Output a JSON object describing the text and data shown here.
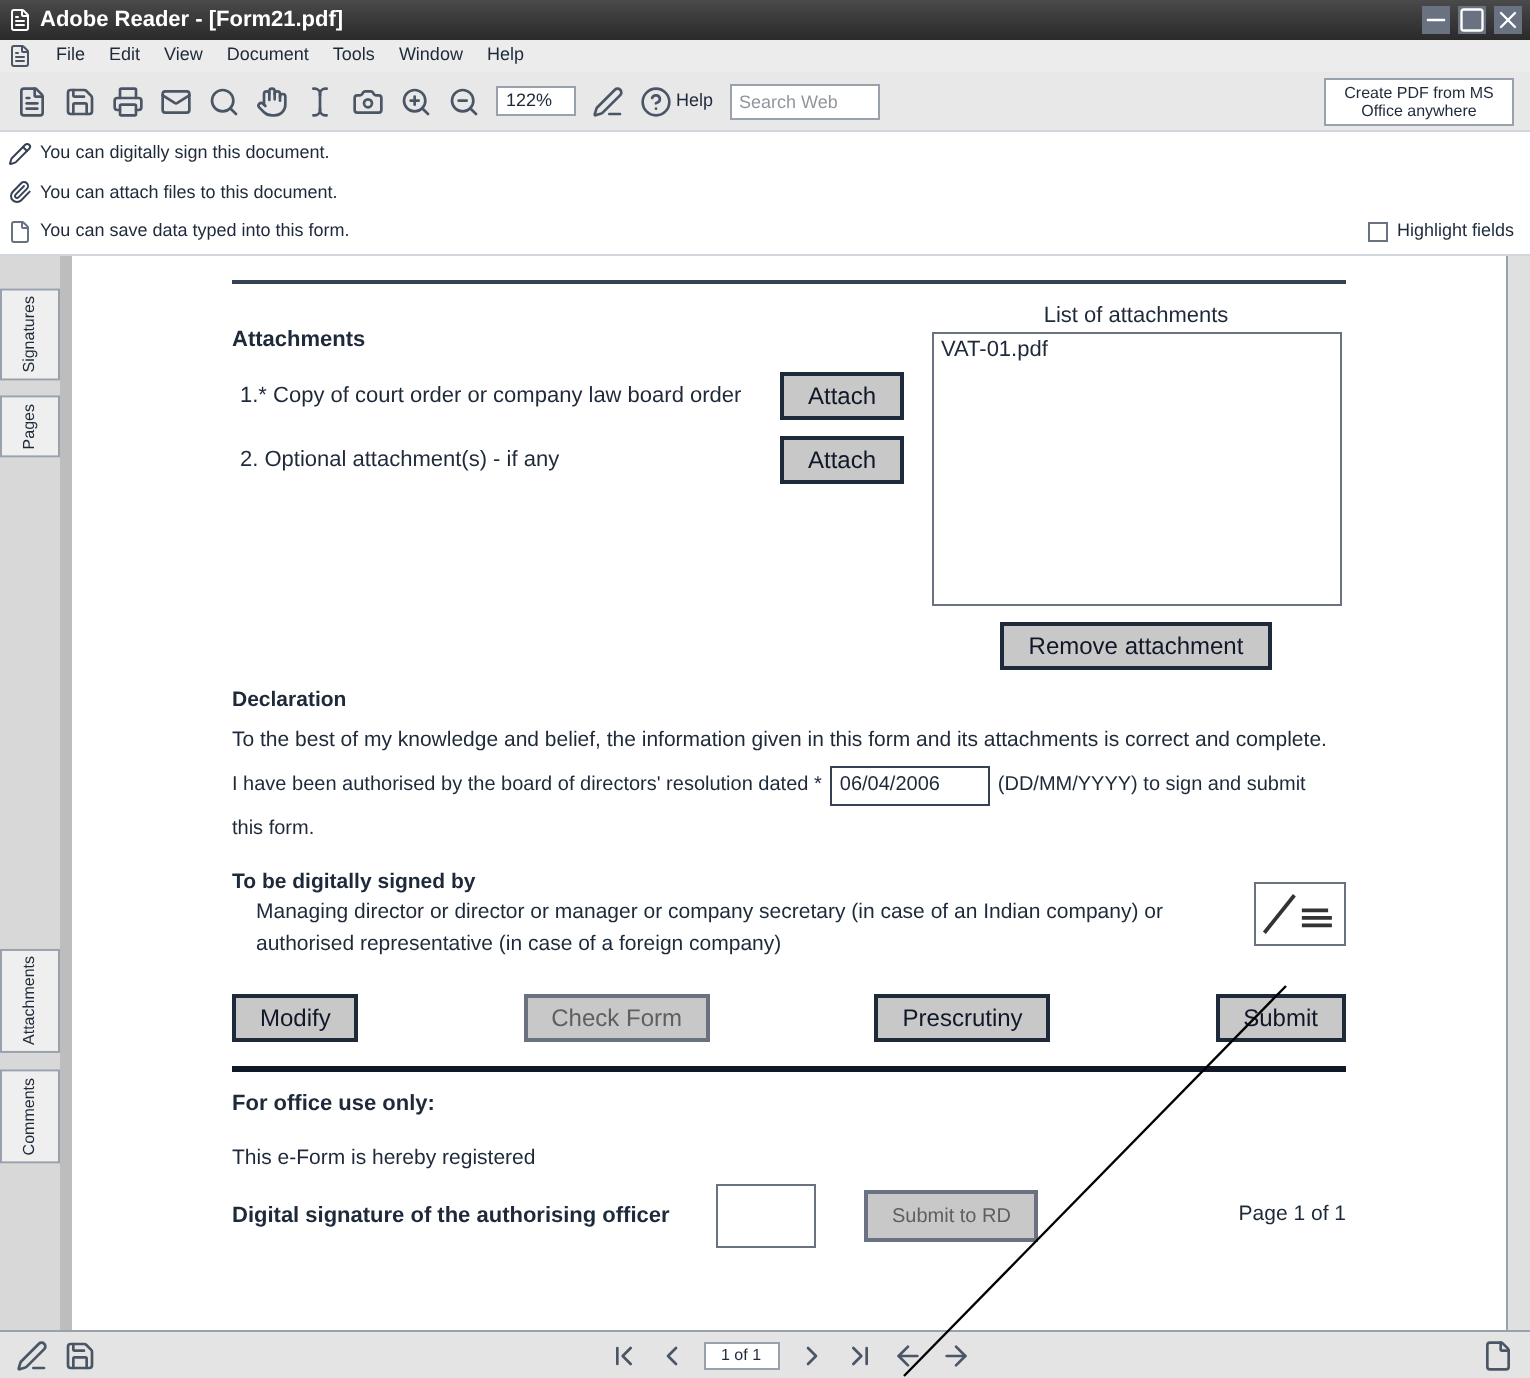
{
  "window": {
    "title": "Adobe Reader - [Form21.pdf]"
  },
  "menu": [
    "File",
    "Edit",
    "View",
    "Document",
    "Tools",
    "Window",
    "Help"
  ],
  "toolbar": {
    "zoom": "122%",
    "help": "Help",
    "search_placeholder": "Search Web",
    "create_pdf": "Create PDF from MS Office anywhere"
  },
  "messages": [
    {
      "kind": "sign",
      "text": "You can digitally sign this document."
    },
    {
      "kind": "attach",
      "text": "You can attach files to this document."
    },
    {
      "kind": "save",
      "text": "You can save data typed into this form."
    }
  ],
  "highlight_fields": {
    "label": "Highlight fields",
    "checked": false
  },
  "side_tabs": [
    {
      "label": "Signatures",
      "selected": false
    },
    {
      "label": "Pages",
      "selected": false
    },
    {
      "label": "Attachments",
      "selected": false
    },
    {
      "label": "Comments",
      "selected": false
    }
  ],
  "attachments": {
    "heading": "Attachments",
    "items": [
      {
        "text": "1.* Copy of court order or company law  board order",
        "button": "Attach"
      },
      {
        "text": "2.  Optional attachment(s) - if any",
        "button": "Attach"
      }
    ],
    "list_label": "List of attachments",
    "list": [
      "VAT-01.pdf"
    ],
    "remove_button": "Remove attachment"
  },
  "declaration": {
    "heading": "Declaration",
    "statement": "To the best of my knowledge and belief, the information given in this form and its attachments is correct and complete.",
    "authorised_before": "I have been authorised by the board of directors' resolution dated *",
    "date": "06/04/2006",
    "authorised_after": "(DD/MM/YYYY) to sign and submit",
    "authorised_end": "this form."
  },
  "signed_by": {
    "heading": "To be digitally signed by",
    "text": "Managing director or director or manager or company secretary (in case of an Indian company) or authorised representative (in case of a foreign company)"
  },
  "actions": [
    {
      "label": "Modify",
      "disabled": false
    },
    {
      "label": "Check Form",
      "disabled": true
    },
    {
      "label": "Prescrutiny",
      "disabled": false
    },
    {
      "label": "Submit",
      "disabled": false
    }
  ],
  "office": {
    "heading": "For office use only:",
    "registered": "This e-Form is hereby registered",
    "signature_label": "Digital signature of the authorising officer",
    "submit_button": "Submit to RD",
    "submit_disabled": true,
    "page": "Page 1 of 1"
  },
  "status_bar": {
    "page_field": "1 of 1"
  }
}
